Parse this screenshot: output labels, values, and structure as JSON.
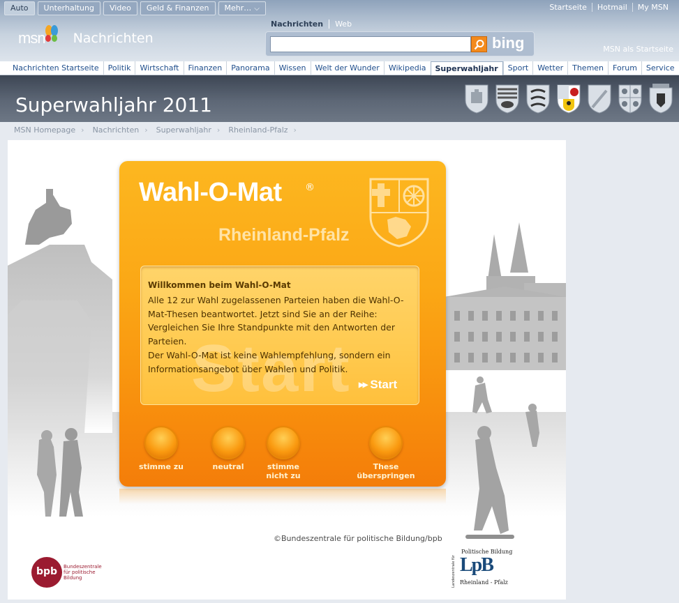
{
  "topnav": [
    {
      "label": "Auto"
    },
    {
      "label": "Unterhaltung"
    },
    {
      "label": "Video"
    },
    {
      "label": "Geld & Finanzen"
    },
    {
      "label": "Mehr…"
    }
  ],
  "toplinks": [
    "Startseite",
    "Hotmail",
    "My MSN"
  ],
  "logo": {
    "brand": "msn",
    "section": "Nachrichten"
  },
  "search": {
    "tabs": [
      "Nachrichten",
      "Web"
    ],
    "value": "",
    "engine": "bing"
  },
  "homepage_link": "MSN als Startseite",
  "catnav": [
    "Nachrichten Startseite",
    "Politik",
    "Wirtschaft",
    "Finanzen",
    "Panorama",
    "Wissen",
    "Welt der Wunder",
    "Wikipedia",
    "Superwahljahr",
    "Sport",
    "Wetter",
    "Themen",
    "Forum",
    "Service"
  ],
  "catnav_active": "Superwahljahr",
  "banner": {
    "title": "Superwahljahr 2011"
  },
  "breadcrumb": [
    "MSN Homepage",
    "Nachrichten",
    "Superwahljahr",
    "Rheinland-Pfalz"
  ],
  "wahlomat": {
    "title": "Wahl-O-Mat",
    "reg": "®",
    "subtitle": "Rheinland-Pfalz",
    "welcome_head": "Willkommen beim Wahl-O-Mat",
    "welcome_text": "Alle 12 zur Wahl zugelassenen Parteien haben die Wahl-O-Mat-Thesen beantwortet. Jetzt sind Sie an der Reihe: Vergleichen Sie Ihre Standpunkte mit den Antworten der Parteien.\nDer Wahl-O-Mat ist keine Wahlempfehlung, sondern ein Informationsangebot über Wahlen und Politik.",
    "start": "Start",
    "ghost": "Start",
    "options": [
      {
        "label": "stimme zu"
      },
      {
        "label": "neutral"
      },
      {
        "label": "stimme\nnicht zu"
      },
      {
        "label": "These\nüberspringen"
      }
    ]
  },
  "copyright": "©Bundeszentrale für politische Bildung/bpb",
  "bpb": {
    "mark": "bpb",
    "text": "Bundeszentrale für politische Bildung"
  },
  "lpb": {
    "top": "Politische Bildung",
    "mark": "LpB",
    "bottom": "Rheinland - Pfalz",
    "side": "Landeszentrale für"
  }
}
